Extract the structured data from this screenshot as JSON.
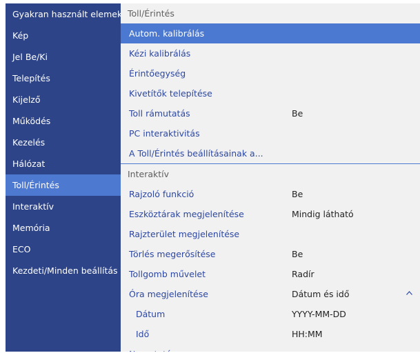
{
  "sidebar": {
    "items": [
      {
        "label": "Gyakran használt elemek"
      },
      {
        "label": "Kép"
      },
      {
        "label": "Jel Be/Ki"
      },
      {
        "label": "Telepítés"
      },
      {
        "label": "Kijelző"
      },
      {
        "label": "Működés"
      },
      {
        "label": "Kezelés"
      },
      {
        "label": "Hálózat"
      },
      {
        "label": "Toll/Érintés"
      },
      {
        "label": "Interaktív"
      },
      {
        "label": "Memória"
      },
      {
        "label": "ECO"
      },
      {
        "label": "Kezdeti/Minden beállítás"
      }
    ]
  },
  "main": {
    "section1": {
      "title": "Toll/Érintés",
      "items": [
        {
          "label": "Autom. kalibrálás"
        },
        {
          "label": "Kézi kalibrálás"
        },
        {
          "label": "Érintőegység"
        },
        {
          "label": "Kivetítők telepítése"
        },
        {
          "label": "Toll rámutatás",
          "value": "Be"
        },
        {
          "label": "PC interaktivitás"
        },
        {
          "label": "A Toll/Érintés beállításainak a..."
        }
      ]
    },
    "section2": {
      "title": "Interaktív",
      "items": [
        {
          "label": "Rajzoló funkció",
          "value": "Be"
        },
        {
          "label": "Eszköztárak megjelenítése",
          "value": "Mindig látható"
        },
        {
          "label": "Rajzterület megjelenítése"
        },
        {
          "label": "Törlés megerősítése",
          "value": "Be"
        },
        {
          "label": "Tollgomb művelet",
          "value": "Radír"
        },
        {
          "label": "Óra megjelenítése",
          "value": "Dátum és idő"
        },
        {
          "label": "Dátum",
          "value": "YYYY-MM-DD"
        },
        {
          "label": "Idő",
          "value": "HH:MM"
        },
        {
          "label": "Nyomtatás"
        }
      ]
    }
  },
  "icons": {
    "clock_expand": "chevron-up-icon"
  },
  "colors": {
    "sidebar_bg": "#2d4488",
    "selection": "#4b78d0",
    "panel_bg": "#f1f1f1",
    "label_text": "#2c47a2"
  }
}
